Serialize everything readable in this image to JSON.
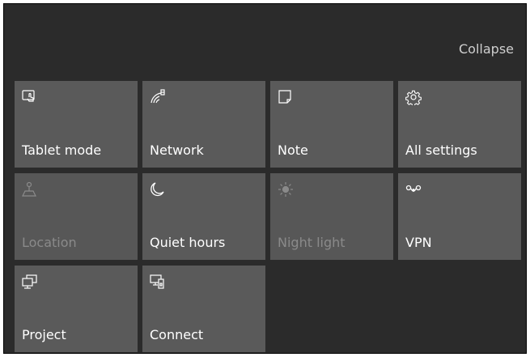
{
  "header": {
    "collapse_label": "Collapse"
  },
  "tiles": [
    {
      "label": "Tablet mode",
      "icon": "tablet-mode-icon",
      "enabled": true
    },
    {
      "label": "Network",
      "icon": "network-icon",
      "enabled": true
    },
    {
      "label": "Note",
      "icon": "note-icon",
      "enabled": true
    },
    {
      "label": "All settings",
      "icon": "gear-icon",
      "enabled": true
    },
    {
      "label": "Location",
      "icon": "location-icon",
      "enabled": false
    },
    {
      "label": "Quiet hours",
      "icon": "moon-icon",
      "enabled": true
    },
    {
      "label": "Night light",
      "icon": "sun-icon",
      "enabled": false
    },
    {
      "label": "VPN",
      "icon": "vpn-icon",
      "enabled": true
    },
    {
      "label": "Project",
      "icon": "project-icon",
      "enabled": true
    },
    {
      "label": "Connect",
      "icon": "connect-icon",
      "enabled": true
    }
  ],
  "colors": {
    "panel_background": "#2b2b2b",
    "tile_background": "#5a5a5a",
    "tile_text": "#ffffff",
    "tile_text_disabled": "#8a8a8a",
    "collapse_text": "#cfcfcf"
  }
}
